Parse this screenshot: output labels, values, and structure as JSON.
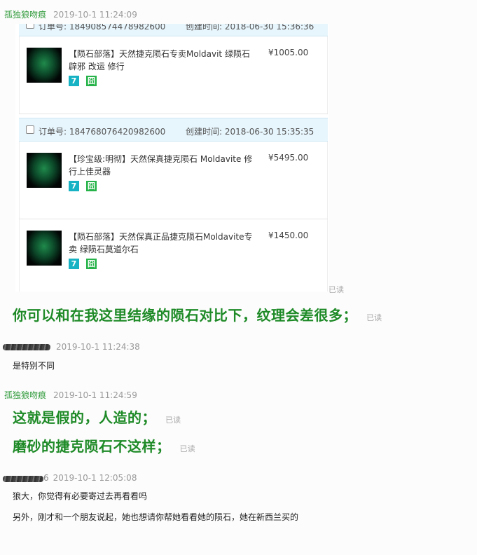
{
  "messages": [
    {
      "sender": "孤独狼吻痕",
      "time": "2019-10-1 11:24:09"
    },
    {
      "time": "2019-10-1 11:24:38",
      "text": "是特别不同"
    },
    {
      "sender": "孤独狼吻痕",
      "time": "2019-10-1 11:24:59"
    },
    {
      "sender_suffix": "6",
      "time": "2019-10-1 12:05:08",
      "line1": "狼大，你觉得有必要寄过去再看看吗",
      "line2": "另外，刚才和一个朋友说起，她也想请你帮她看看她的陨石，她在新西兰买的"
    }
  ],
  "big_texts": [
    "你可以和在我这里结缘的陨石对比下，纹理会差很多；",
    "这就是假的，人造的；",
    "磨砂的捷克陨石不这样；"
  ],
  "read_label": "已读",
  "orders": [
    {
      "no_label": "订单号: 184908574478982600",
      "time_label": "创建时间: 2018-06-30 15:36:36"
    },
    {
      "no_label": "订单号: 184768076420982600",
      "time_label": "创建时间: 2018-06-30 15:35:35"
    }
  ],
  "items": [
    {
      "title": "【陨石部落】天然捷克陨石专卖Moldavit 绿陨石 辟邪 改运 修行",
      "price": "¥1005.00"
    },
    {
      "title": "【珍宝级:明彻】天然保真捷克陨石 Moldavite 修行上佳灵器",
      "price": "¥5495.00"
    },
    {
      "title": "【陨石部落】天然保真正品捷克陨石Moldavite专卖 绿陨石莫道尔石",
      "price": "¥1450.00"
    }
  ],
  "tags": {
    "a": "7",
    "b": "囧"
  },
  "colors": {
    "sender": "#2f9a3a",
    "big_text": "#1e8a27",
    "order_header": "#e7f5fc"
  }
}
